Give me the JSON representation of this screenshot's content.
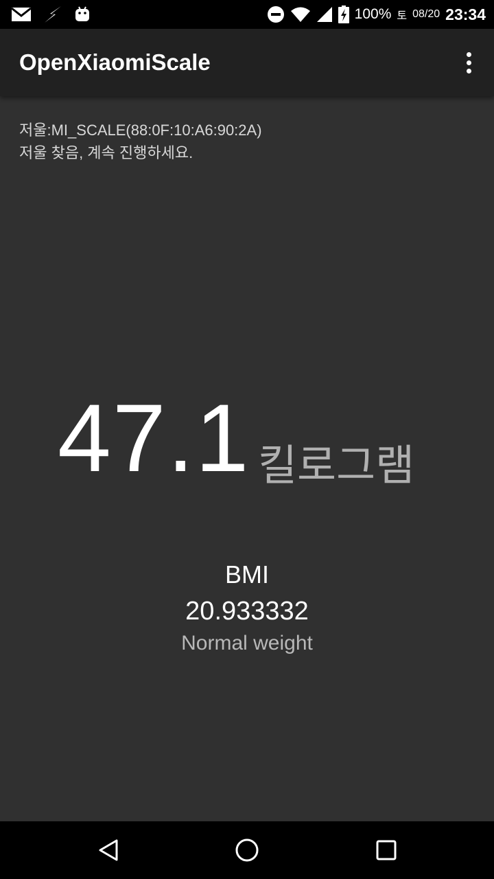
{
  "status_bar": {
    "battery": "100%",
    "day": "토",
    "date": "08/20",
    "time": "23:34",
    "icons": [
      "mail-icon",
      "flash-icon",
      "android-icon",
      "do-not-disturb-icon",
      "wifi-icon",
      "signal-icon",
      "battery-charging-icon"
    ]
  },
  "app_bar": {
    "title": "OpenXiaomiScale",
    "menu_icon": "overflow-menu-icon"
  },
  "main": {
    "device_line": "저울:MI_SCALE(88:0F:10:A6:90:2A)",
    "status_message": "저울 찾음, 계속 진행하세요.",
    "weight": "47.1",
    "weight_unit": "킬로그램",
    "bmi_label": "BMI",
    "bmi_value": "20.933332",
    "bmi_category": "Normal weight"
  },
  "nav_bar": {
    "icons": [
      "back-icon",
      "home-icon",
      "recents-icon"
    ]
  },
  "colors": {
    "background": "#303030",
    "app_bar": "#212121",
    "system_bars": "#000000",
    "primary_text": "#ffffff",
    "secondary_text": "#b0b0b0"
  }
}
